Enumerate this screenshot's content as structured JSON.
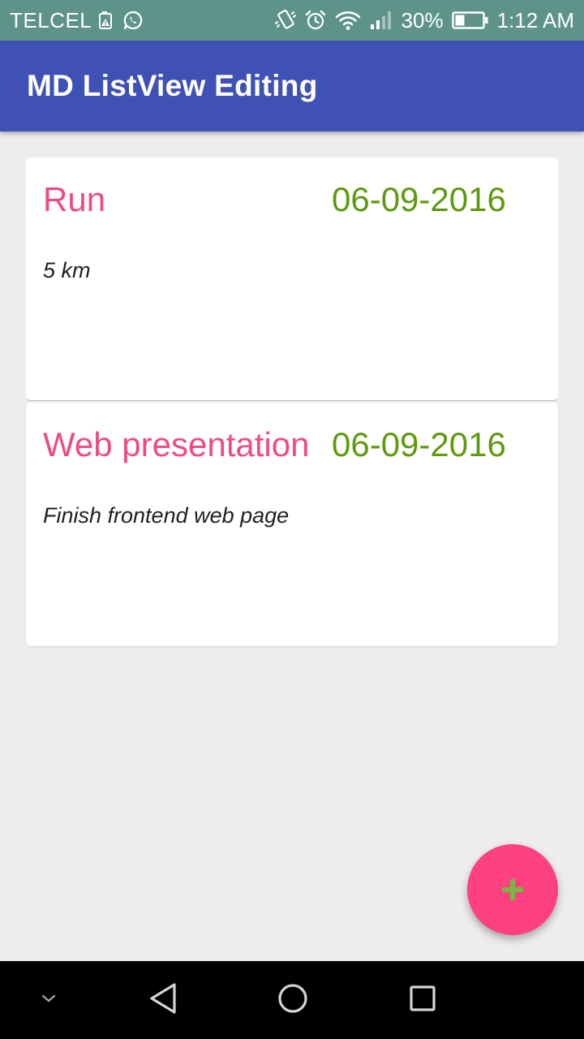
{
  "status_bar": {
    "carrier": "TELCEL",
    "battery_percent": "30%",
    "time": "1:12 AM",
    "icons": {
      "left": [
        "battery-warning-icon",
        "whatsapp-icon"
      ],
      "right": [
        "vibrate-icon",
        "alarm-icon",
        "wifi-icon",
        "signal-icon",
        "battery-icon"
      ]
    }
  },
  "app_bar": {
    "title": "MD ListView Editing"
  },
  "list": {
    "items": [
      {
        "title": "Run",
        "date": "06-09-2016",
        "description": "5 km"
      },
      {
        "title": "Web presentation",
        "date": "06-09-2016",
        "description": "Finish frontend web page"
      }
    ]
  },
  "fab": {
    "icon": "plus-icon"
  },
  "nav_bar": {
    "icons": [
      "chevron-down-icon",
      "back-icon",
      "home-icon",
      "recents-icon"
    ]
  },
  "colors": {
    "status_bar": "#5d9388",
    "app_bar": "#3f51b5",
    "background": "#ededed",
    "title_pink": "#ef4a84",
    "date_green": "#5d9a0d",
    "fab": "#ff4081",
    "fab_plus": "#7cb342"
  }
}
